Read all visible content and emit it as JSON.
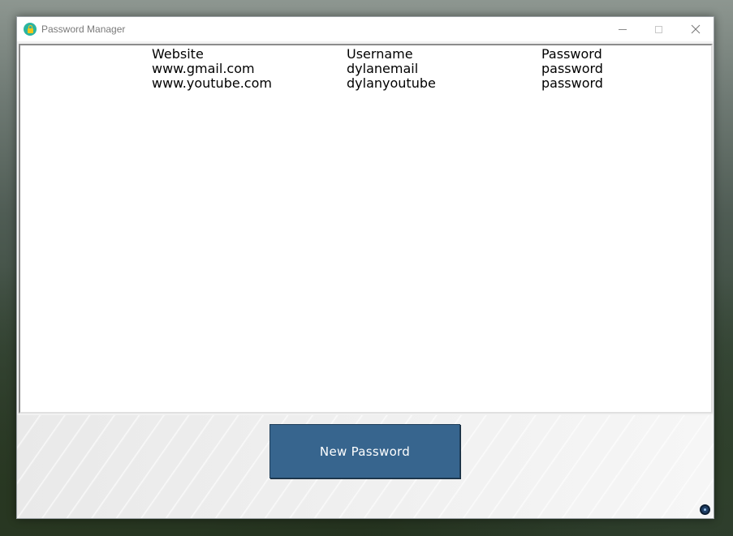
{
  "window": {
    "title": "Password Manager"
  },
  "table": {
    "headers": [
      "Website",
      "Username",
      "Password"
    ],
    "rows": [
      [
        "www.gmail.com",
        "dylanemail",
        "password"
      ],
      [
        "www.youtube.com",
        "dylanyoutube",
        "password"
      ]
    ]
  },
  "actions": {
    "new_password_label": "New Password"
  },
  "colors": {
    "button_bg": "#37658e",
    "button_text": "#ffffff",
    "app_icon": "#2bb5a0"
  },
  "icons": {
    "app": "lock-icon",
    "minimize": "minimize-icon",
    "maximize": "maximize-icon",
    "close": "close-icon",
    "tray": "tray-icon"
  }
}
